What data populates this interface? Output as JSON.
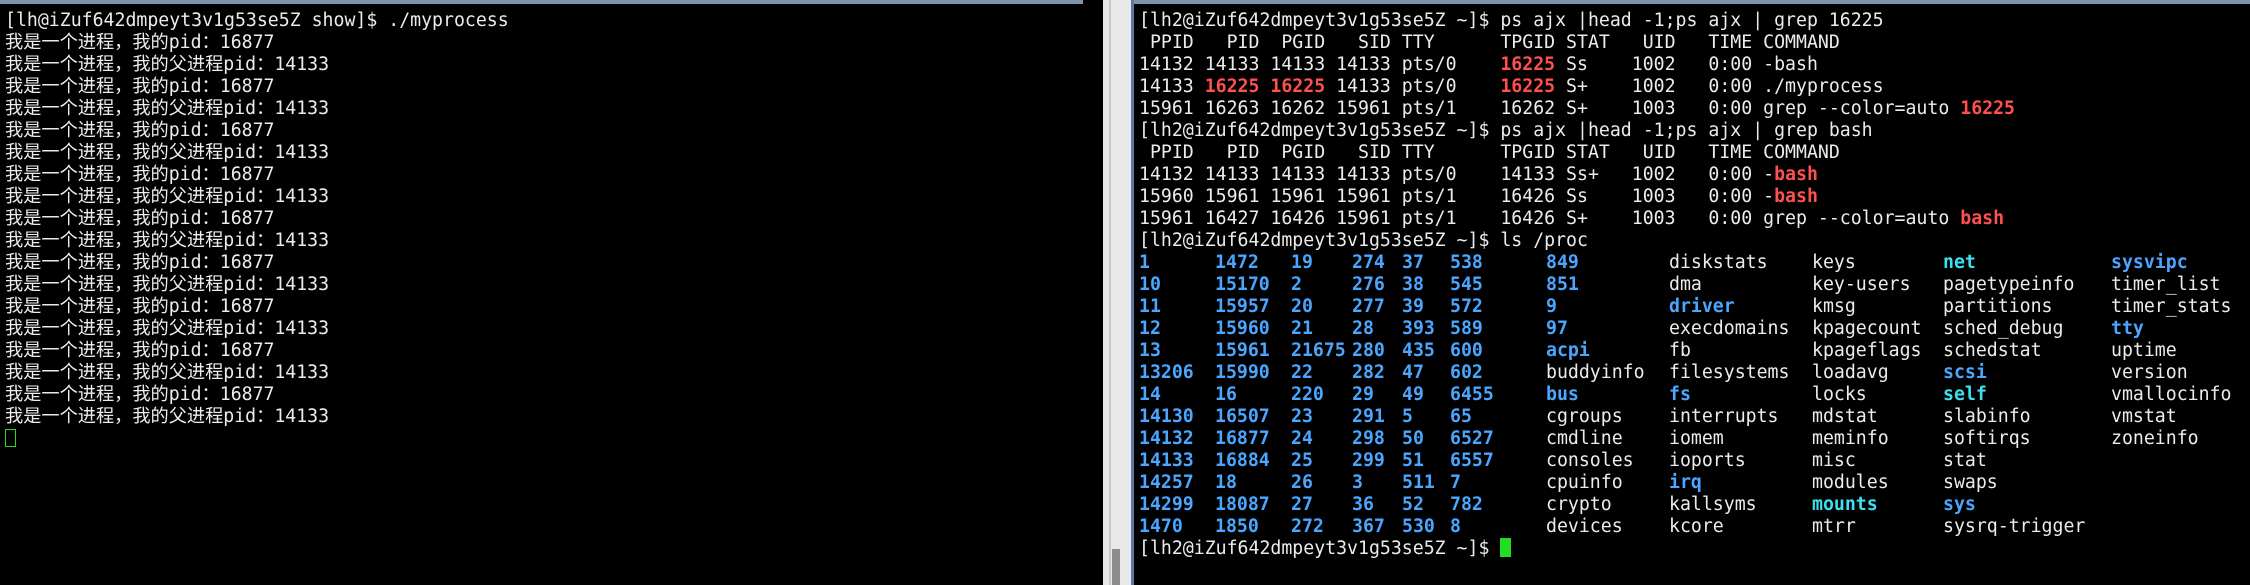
{
  "colors": {
    "background": "#000000",
    "foreground": "#ececec",
    "highlight": "#ff5050",
    "dir_blue": "#4aa6ff",
    "link_cyan": "#3ce0f0",
    "cursor": "#22dd22",
    "window_titlebar": "#7f93ad",
    "scrollbar": "#e9e9e9"
  },
  "left_terminal": {
    "prompt": "[lh@iZuf642dmpeyt3v1g53se5Z show]$ ./myprocess",
    "output": [
      {
        "cn": "我是一个进程，我的",
        "label": "pid：",
        "value": "16877"
      },
      {
        "cn": "我是一个进程，我的父进程",
        "label": "pid：",
        "value": "14133"
      },
      {
        "cn": "我是一个进程，我的",
        "label": "pid：",
        "value": "16877"
      },
      {
        "cn": "我是一个进程，我的父进程",
        "label": "pid：",
        "value": "14133"
      },
      {
        "cn": "我是一个进程，我的",
        "label": "pid：",
        "value": "16877"
      },
      {
        "cn": "我是一个进程，我的父进程",
        "label": "pid：",
        "value": "14133"
      },
      {
        "cn": "我是一个进程，我的",
        "label": "pid：",
        "value": "16877"
      },
      {
        "cn": "我是一个进程，我的父进程",
        "label": "pid：",
        "value": "14133"
      },
      {
        "cn": "我是一个进程，我的",
        "label": "pid：",
        "value": "16877"
      },
      {
        "cn": "我是一个进程，我的父进程",
        "label": "pid：",
        "value": "14133"
      },
      {
        "cn": "我是一个进程，我的",
        "label": "pid：",
        "value": "16877"
      },
      {
        "cn": "我是一个进程，我的父进程",
        "label": "pid：",
        "value": "14133"
      },
      {
        "cn": "我是一个进程，我的",
        "label": "pid：",
        "value": "16877"
      },
      {
        "cn": "我是一个进程，我的父进程",
        "label": "pid：",
        "value": "14133"
      },
      {
        "cn": "我是一个进程，我的",
        "label": "pid：",
        "value": "16877"
      },
      {
        "cn": "我是一个进程，我的父进程",
        "label": "pid：",
        "value": "14133"
      },
      {
        "cn": "我是一个进程，我的",
        "label": "pid：",
        "value": "16877"
      },
      {
        "cn": "我是一个进程，我的父进程",
        "label": "pid：",
        "value": "14133"
      }
    ]
  },
  "right_terminal": {
    "cmd1": "[lh2@iZuf642dmpeyt3v1g53se5Z ~]$ ps ajx |head -1;ps ajx | grep 16225",
    "header1": " PPID   PID  PGID   SID TTY      TPGID STAT   UID   TIME COMMAND",
    "rows1": [
      [
        "14132 14133 14133 14133 pts/0    ",
        "16225",
        " Ss    1002   0:00 -bash"
      ],
      [
        "14133 ",
        "16225",
        " ",
        "16225",
        " 14133 pts/0    ",
        "16225",
        " S+    1002   0:00 ./myprocess"
      ],
      [
        "15961 16263 16262 15961 pts/1    16262 S+    1003   0:00 grep --color=auto ",
        "16225"
      ]
    ],
    "cmd2": "[lh2@iZuf642dmpeyt3v1g53se5Z ~]$ ps ajx |head -1;ps ajx | grep bash",
    "header2": " PPID   PID  PGID   SID TTY      TPGID STAT   UID   TIME COMMAND",
    "rows2": [
      [
        "14132 14133 14133 14133 pts/0    14133 Ss+   1002   0:00 -",
        "bash"
      ],
      [
        "15960 15961 15961 15961 pts/1    16426 Ss    1003   0:00 -",
        "bash"
      ],
      [
        "15961 16427 16426 15961 pts/1    16426 S+    1003   0:00 grep --color=auto ",
        "bash"
      ]
    ],
    "cmd3": "[lh2@iZuf642dmpeyt3v1g53se5Z ~]$ ls /proc",
    "ls_rows": [
      [
        "1",
        "1472",
        "19",
        "274",
        "37",
        "538",
        "849",
        "diskstats",
        "keys",
        "net",
        "sysvipc"
      ],
      [
        "10",
        "15170",
        "2",
        "276",
        "38",
        "545",
        "851",
        "dma",
        "key-users",
        "pagetypeinfo",
        "timer_list"
      ],
      [
        "11",
        "15957",
        "20",
        "277",
        "39",
        "572",
        "9",
        "driver",
        "kmsg",
        "partitions",
        "timer_stats"
      ],
      [
        "12",
        "15960",
        "21",
        "28",
        "393",
        "589",
        "97",
        "execdomains",
        "kpagecount",
        "sched_debug",
        "tty"
      ],
      [
        "13",
        "15961",
        "21675",
        "280",
        "435",
        "600",
        "acpi",
        "fb",
        "kpageflags",
        "schedstat",
        "uptime"
      ],
      [
        "13206",
        "15990",
        "22",
        "282",
        "47",
        "602",
        "buddyinfo",
        "filesystems",
        "loadavg",
        "scsi",
        "version"
      ],
      [
        "14",
        "16",
        "220",
        "29",
        "49",
        "6455",
        "bus",
        "fs",
        "locks",
        "self",
        "vmallocinfo"
      ],
      [
        "14130",
        "16507",
        "23",
        "291",
        "5",
        "65",
        "cgroups",
        "interrupts",
        "mdstat",
        "slabinfo",
        "vmstat"
      ],
      [
        "14132",
        "16877",
        "24",
        "298",
        "50",
        "6527",
        "cmdline",
        "iomem",
        "meminfo",
        "softirqs",
        "zoneinfo"
      ],
      [
        "14133",
        "16884",
        "25",
        "299",
        "51",
        "6557",
        "consoles",
        "ioports",
        "misc",
        "stat",
        ""
      ],
      [
        "14257",
        "18",
        "26",
        "3",
        "511",
        "7",
        "cpuinfo",
        "irq",
        "modules",
        "swaps",
        ""
      ],
      [
        "14299",
        "18087",
        "27",
        "36",
        "52",
        "782",
        "crypto",
        "kallsyms",
        "mounts",
        "sys",
        ""
      ],
      [
        "1470",
        "1850",
        "272",
        "367",
        "530",
        "8",
        "devices",
        "kcore",
        "mtrr",
        "sysrq-trigger",
        ""
      ]
    ],
    "ls_styles": [
      [
        "blue",
        "blue",
        "blue",
        "blue",
        "blue",
        "blue",
        "blue",
        "",
        "",
        "cyan",
        "blue"
      ],
      [
        "blue",
        "blue",
        "blue",
        "blue",
        "blue",
        "blue",
        "blue",
        "",
        "",
        "",
        ""
      ],
      [
        "blue",
        "blue",
        "blue",
        "blue",
        "blue",
        "blue",
        "blue",
        "blue",
        "",
        "",
        ""
      ],
      [
        "blue",
        "blue",
        "blue",
        "blue",
        "blue",
        "blue",
        "blue",
        "",
        "",
        "",
        "blue"
      ],
      [
        "blue",
        "blue",
        "blue",
        "blue",
        "blue",
        "blue",
        "blue",
        "",
        "",
        "",
        ""
      ],
      [
        "blue",
        "blue",
        "blue",
        "blue",
        "blue",
        "blue",
        "",
        "",
        "",
        "blue",
        ""
      ],
      [
        "blue",
        "blue",
        "blue",
        "blue",
        "blue",
        "blue",
        "blue",
        "blue",
        "",
        "cyan",
        ""
      ],
      [
        "blue",
        "blue",
        "blue",
        "blue",
        "blue",
        "blue",
        "",
        "",
        "",
        "",
        ""
      ],
      [
        "blue",
        "blue",
        "blue",
        "blue",
        "blue",
        "blue",
        "",
        "",
        "",
        "",
        ""
      ],
      [
        "blue",
        "blue",
        "blue",
        "blue",
        "blue",
        "blue",
        "",
        "",
        "",
        "",
        ""
      ],
      [
        "blue",
        "blue",
        "blue",
        "blue",
        "blue",
        "blue",
        "",
        "blue",
        "",
        "",
        ""
      ],
      [
        "blue",
        "blue",
        "blue",
        "blue",
        "blue",
        "blue",
        "",
        "",
        "cyan",
        "blue",
        ""
      ],
      [
        "blue",
        "blue",
        "blue",
        "blue",
        "blue",
        "blue",
        "",
        "",
        "",
        "",
        ""
      ]
    ],
    "final_prompt": "[lh2@iZuf642dmpeyt3v1g53se5Z ~]$ "
  }
}
